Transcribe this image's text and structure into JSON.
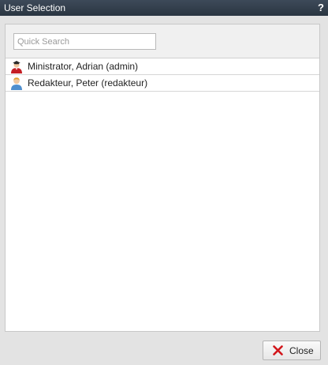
{
  "dialog": {
    "title": "User Selection",
    "help_label": "?"
  },
  "search": {
    "placeholder": "Quick Search",
    "value": ""
  },
  "users": [
    {
      "label": "Ministrator, Adrian (admin)",
      "icon": "admin-user-icon"
    },
    {
      "label": "Redakteur, Peter (redakteur)",
      "icon": "user-icon"
    }
  ],
  "footer": {
    "close_label": "Close"
  },
  "colors": {
    "titlebar": "#2f3b48",
    "close_icon": "#d2161b",
    "admin_shirt": "#c41e24",
    "user_shirt": "#4f8fce"
  }
}
